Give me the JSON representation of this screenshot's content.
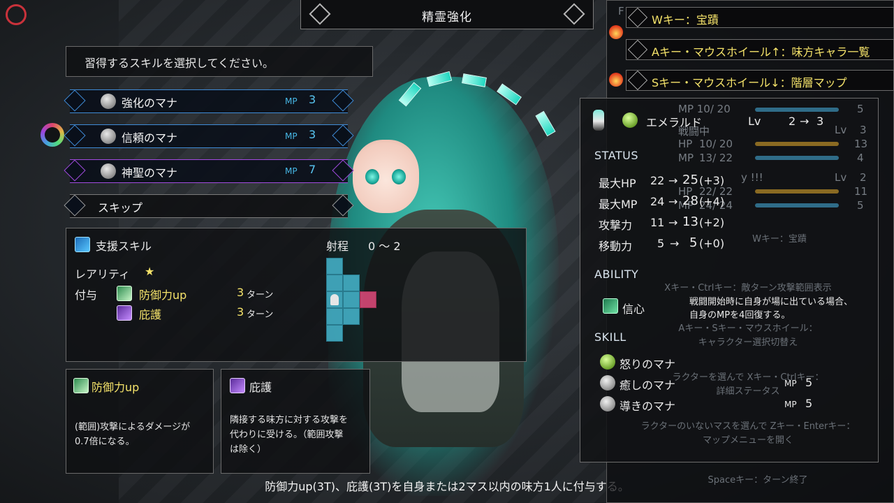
{
  "window": {
    "title": "精霊強化"
  },
  "instruction": "習得するスキルを選択してください。",
  "skill_options": [
    {
      "name": "強化のマナ",
      "mp_label": "MP",
      "mp": "3"
    },
    {
      "name": "信頼のマナ",
      "mp_label": "MP",
      "mp": "3"
    },
    {
      "name": "神聖のマナ",
      "mp_label": "MP",
      "mp": "7"
    },
    {
      "name": "スキップ"
    }
  ],
  "detail": {
    "type": "支援スキル",
    "range_label": "射程",
    "range_value": "0 〜 2",
    "rarity_label": "レアリティ",
    "rarity_stars": "★",
    "grant_label": "付与",
    "effects": [
      {
        "name": "防御力up",
        "turns": "3",
        "turn_unit": "ターン"
      },
      {
        "name": "庇護",
        "turns": "3",
        "turn_unit": "ターン"
      }
    ]
  },
  "effect_panels": [
    {
      "title": "防御力up",
      "body": "(範囲)攻撃によるダメージが\n0.7倍になる。"
    },
    {
      "title": "庇護",
      "body": "隣接する味方に対する攻撃を\n代わりに受ける。（範囲攻撃\nは除く）"
    }
  ],
  "bottom_description": "防御力up(3T)、庇護(3T)を自身または2マス以内の味方1人に付与する。",
  "hints": [
    "Wキー：宝蹟",
    "Aキー・マウスホイール↑：味方キャラ一覧",
    "Sキー・マウスホイール↓：階層マップ"
  ],
  "character": {
    "name": "エメラルド",
    "lv_label": "Lv",
    "lv_from": "2",
    "lv_arrow": "→",
    "lv_to": "3",
    "status_header": "STATUS",
    "stats": [
      {
        "label": "最大HP",
        "from": "22",
        "arrow": "→",
        "to": "25",
        "delta": "(+3)"
      },
      {
        "label": "最大MP",
        "from": "24",
        "arrow": "→",
        "to": "28",
        "delta": "(+4)"
      },
      {
        "label": "攻撃力",
        "from": "11",
        "arrow": "→",
        "to": "13",
        "delta": "(+2)"
      },
      {
        "label": "移動力",
        "from": "5",
        "arrow": "→",
        "to": "5",
        "delta": "(+0)"
      }
    ],
    "ability_header": "ABILITY",
    "ability": {
      "name": "信心",
      "desc": "戦闘開始時に自身が場に出ている場合、\n自身のMPを4回復する。"
    },
    "skill_header": "SKILL",
    "skills": [
      {
        "name": "怒りのマナ",
        "mp_label": "",
        "mp": ""
      },
      {
        "name": "癒しのマナ",
        "mp_label": "MP",
        "mp": "5"
      },
      {
        "name": "導きのマナ",
        "mp_label": "MP",
        "mp": "5"
      }
    ]
  },
  "background_ui": {
    "party_header": "F",
    "rows": [
      {
        "state": "戦闘中",
        "hp_label": "HP",
        "hp": "10/ 20",
        "mp_label": "MP",
        "mp": "13/ 22",
        "lv_label": "Lv",
        "lv": "3",
        "atk": "13",
        "mov": "4"
      },
      {
        "state": "y !!!",
        "hp_label": "HP",
        "hp": "22/ 22",
        "mp_label": "MP",
        "mp": "24/ 24",
        "lv_label": "Lv",
        "lv": "2",
        "atk": "11",
        "mov": "5"
      }
    ],
    "mp_partial": "MP  10/  20",
    "mov_partial": "5",
    "help_lines": [
      "Wキー：宝蹟",
      "Xキー・Ctrlキー：敵ターン攻撃範囲表示",
      "Aキー・Sキー・マウスホイール：",
      "キャラクター選択切替え",
      "ラクターを選んで Xキー・Ctrlキー：",
      "詳細ステータス",
      "ラクターのいないマスを選んで Zキー・Enterキー：",
      "マップメニューを開く",
      "Spaceキー：ターン終了"
    ]
  },
  "colors": {
    "accent_yellow": "#f5e36a",
    "mp_blue": "#59c6f2",
    "row_blue": "#3f8bd6",
    "row_purple": "#a24be0"
  }
}
